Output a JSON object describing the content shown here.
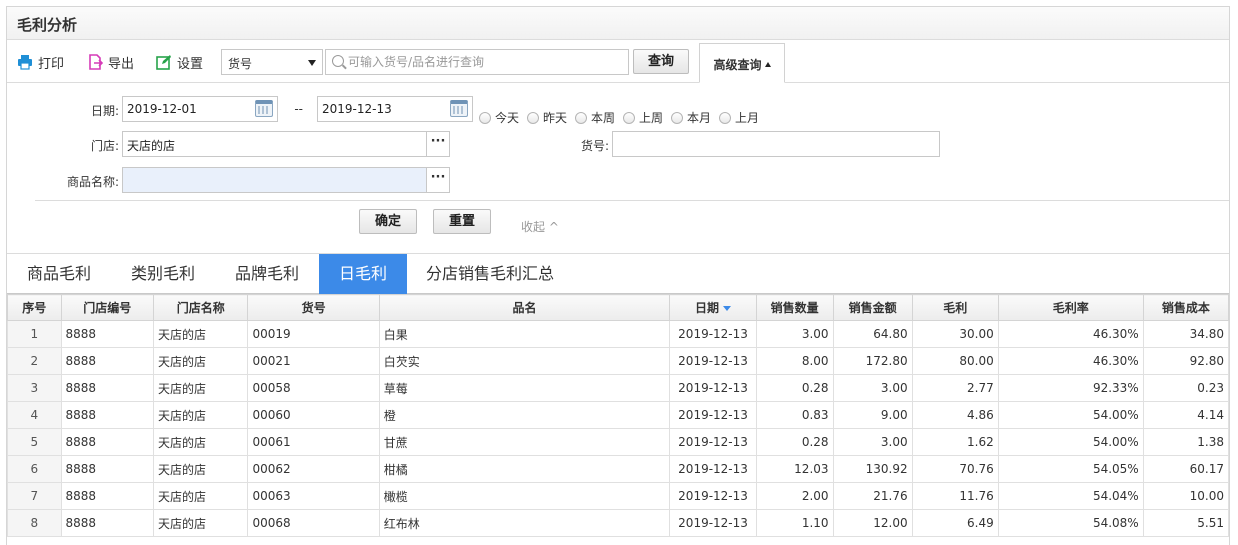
{
  "title": "毛利分析",
  "toolbar": {
    "print": "打印",
    "export": "导出",
    "settings": "设置",
    "field_select": "货号",
    "search_placeholder": "可输入货号/品名进行查询",
    "query": "查询",
    "advanced": "高级查询"
  },
  "filters": {
    "date_label": "日期:",
    "date_from": "2019-12-01",
    "date_sep": "--",
    "date_to": "2019-12-13",
    "quick_dates": [
      "今天",
      "昨天",
      "本周",
      "上周",
      "本月",
      "上月"
    ],
    "store_label": "门店:",
    "store_value": "天店的店",
    "code_label": "货号:",
    "code_value": "",
    "name_label": "商品名称:",
    "name_value": "",
    "confirm": "确定",
    "reset": "重置",
    "collapse": "收起 ^"
  },
  "tabs": [
    "商品毛利",
    "类别毛利",
    "品牌毛利",
    "日毛利",
    "分店销售毛利汇总"
  ],
  "active_tab": 3,
  "colors": {
    "accent": "#3c8ae8",
    "radio_border": "#b5b5b5"
  },
  "table": {
    "columns": [
      "序号",
      "门店编号",
      "门店名称",
      "货号",
      "品名",
      "日期",
      "销售数量",
      "销售金额",
      "毛利",
      "毛利率",
      "销售成本"
    ],
    "sort_column": "日期",
    "rows": [
      [
        "1",
        "8888",
        "天店的店",
        "00019",
        "白果",
        "2019-12-13",
        "3.00",
        "64.80",
        "30.00",
        "46.30%",
        "34.80"
      ],
      [
        "2",
        "8888",
        "天店的店",
        "00021",
        "白芡实",
        "2019-12-13",
        "8.00",
        "172.80",
        "80.00",
        "46.30%",
        "92.80"
      ],
      [
        "3",
        "8888",
        "天店的店",
        "00058",
        "草莓",
        "2019-12-13",
        "0.28",
        "3.00",
        "2.77",
        "92.33%",
        "0.23"
      ],
      [
        "4",
        "8888",
        "天店的店",
        "00060",
        "橙",
        "2019-12-13",
        "0.83",
        "9.00",
        "4.86",
        "54.00%",
        "4.14"
      ],
      [
        "5",
        "8888",
        "天店的店",
        "00061",
        "甘蔗",
        "2019-12-13",
        "0.28",
        "3.00",
        "1.62",
        "54.00%",
        "1.38"
      ],
      [
        "6",
        "8888",
        "天店的店",
        "00062",
        "柑橘",
        "2019-12-13",
        "12.03",
        "130.92",
        "70.76",
        "54.05%",
        "60.17"
      ],
      [
        "7",
        "8888",
        "天店的店",
        "00063",
        "橄榄",
        "2019-12-13",
        "2.00",
        "21.76",
        "11.76",
        "54.04%",
        "10.00"
      ],
      [
        "8",
        "8888",
        "天店的店",
        "00068",
        "红布林",
        "2019-12-13",
        "1.10",
        "12.00",
        "6.49",
        "54.08%",
        "5.51"
      ]
    ]
  }
}
